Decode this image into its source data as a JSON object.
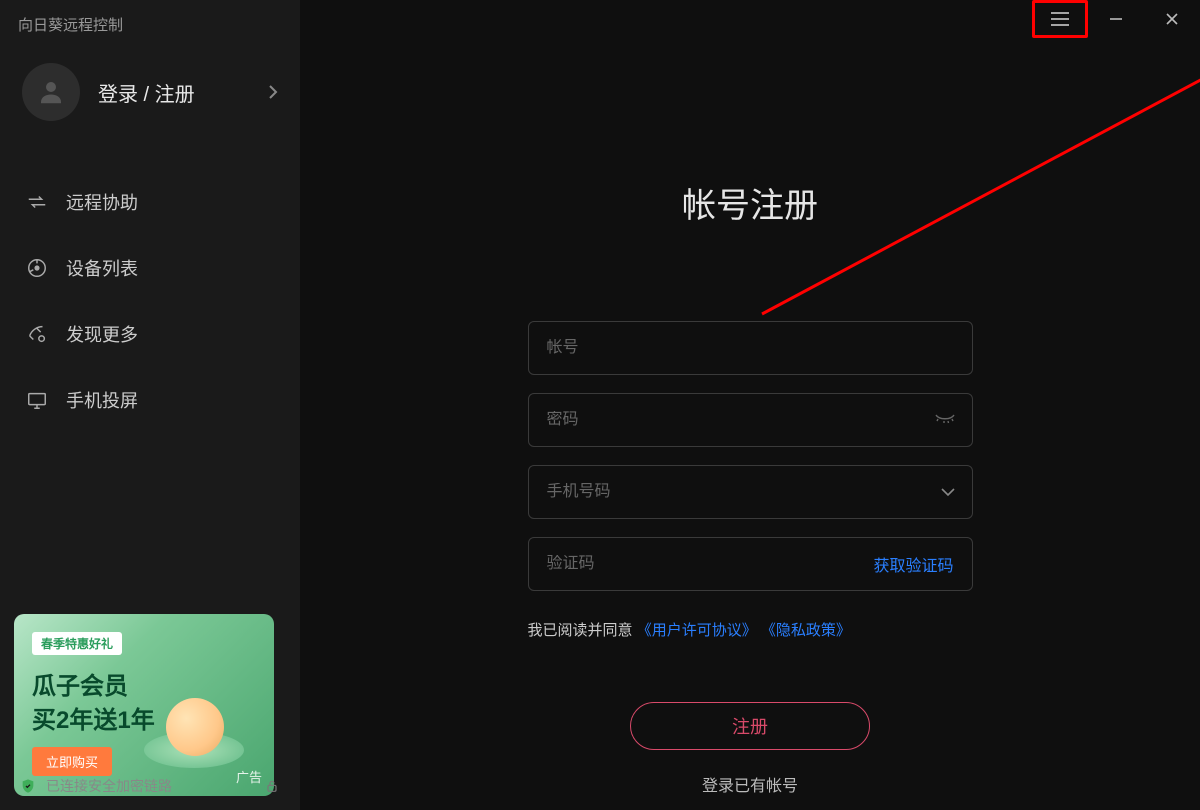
{
  "app_title": "向日葵远程控制",
  "profile": {
    "label": "登录 / 注册"
  },
  "nav": [
    {
      "id": "remote-assist",
      "label": "远程协助"
    },
    {
      "id": "device-list",
      "label": "设备列表"
    },
    {
      "id": "discover-more",
      "label": "发现更多"
    },
    {
      "id": "phone-cast",
      "label": "手机投屏"
    }
  ],
  "ad": {
    "badge": "春季特惠好礼",
    "line1": "瓜子会员",
    "line2": "买2年送1年",
    "button": "立即购买",
    "tag": "广告"
  },
  "status": {
    "text": "已连接安全加密链路"
  },
  "main": {
    "title": "帐号注册",
    "fields": {
      "account": {
        "placeholder": "帐号"
      },
      "password": {
        "placeholder": "密码"
      },
      "phone": {
        "placeholder": "手机号码"
      },
      "code": {
        "placeholder": "验证码",
        "get_code": "获取验证码"
      }
    },
    "agreement": {
      "prefix": "我已阅读并同意",
      "link1": "《用户许可协议》",
      "link2": "《隐私政策》"
    },
    "register_btn": "注册",
    "login_link": "登录已有帐号"
  }
}
